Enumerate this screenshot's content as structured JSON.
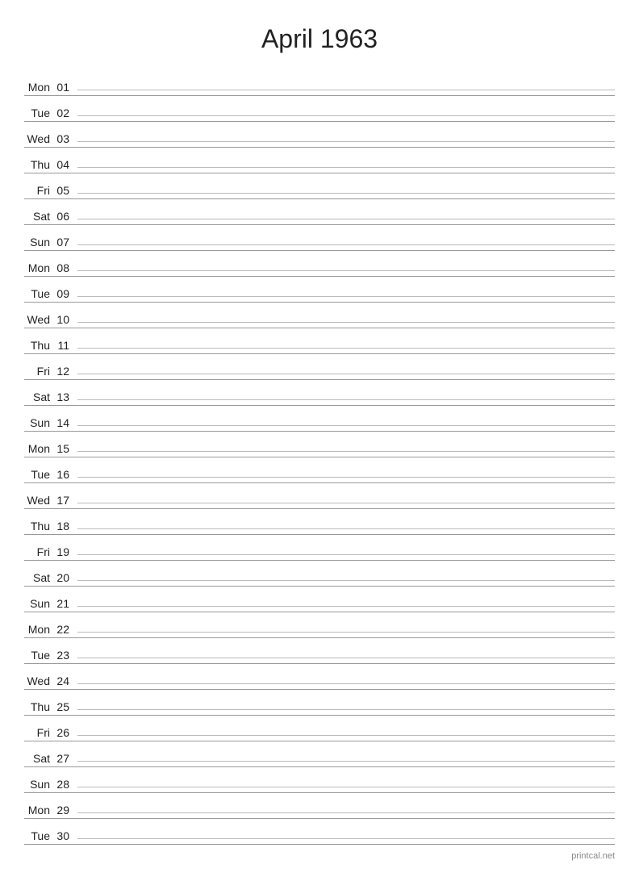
{
  "title": "April 1963",
  "days": [
    {
      "name": "Mon",
      "number": "01"
    },
    {
      "name": "Tue",
      "number": "02"
    },
    {
      "name": "Wed",
      "number": "03"
    },
    {
      "name": "Thu",
      "number": "04"
    },
    {
      "name": "Fri",
      "number": "05"
    },
    {
      "name": "Sat",
      "number": "06"
    },
    {
      "name": "Sun",
      "number": "07"
    },
    {
      "name": "Mon",
      "number": "08"
    },
    {
      "name": "Tue",
      "number": "09"
    },
    {
      "name": "Wed",
      "number": "10"
    },
    {
      "name": "Thu",
      "number": "11"
    },
    {
      "name": "Fri",
      "number": "12"
    },
    {
      "name": "Sat",
      "number": "13"
    },
    {
      "name": "Sun",
      "number": "14"
    },
    {
      "name": "Mon",
      "number": "15"
    },
    {
      "name": "Tue",
      "number": "16"
    },
    {
      "name": "Wed",
      "number": "17"
    },
    {
      "name": "Thu",
      "number": "18"
    },
    {
      "name": "Fri",
      "number": "19"
    },
    {
      "name": "Sat",
      "number": "20"
    },
    {
      "name": "Sun",
      "number": "21"
    },
    {
      "name": "Mon",
      "number": "22"
    },
    {
      "name": "Tue",
      "number": "23"
    },
    {
      "name": "Wed",
      "number": "24"
    },
    {
      "name": "Thu",
      "number": "25"
    },
    {
      "name": "Fri",
      "number": "26"
    },
    {
      "name": "Sat",
      "number": "27"
    },
    {
      "name": "Sun",
      "number": "28"
    },
    {
      "name": "Mon",
      "number": "29"
    },
    {
      "name": "Tue",
      "number": "30"
    }
  ],
  "footer": "printcal.net"
}
